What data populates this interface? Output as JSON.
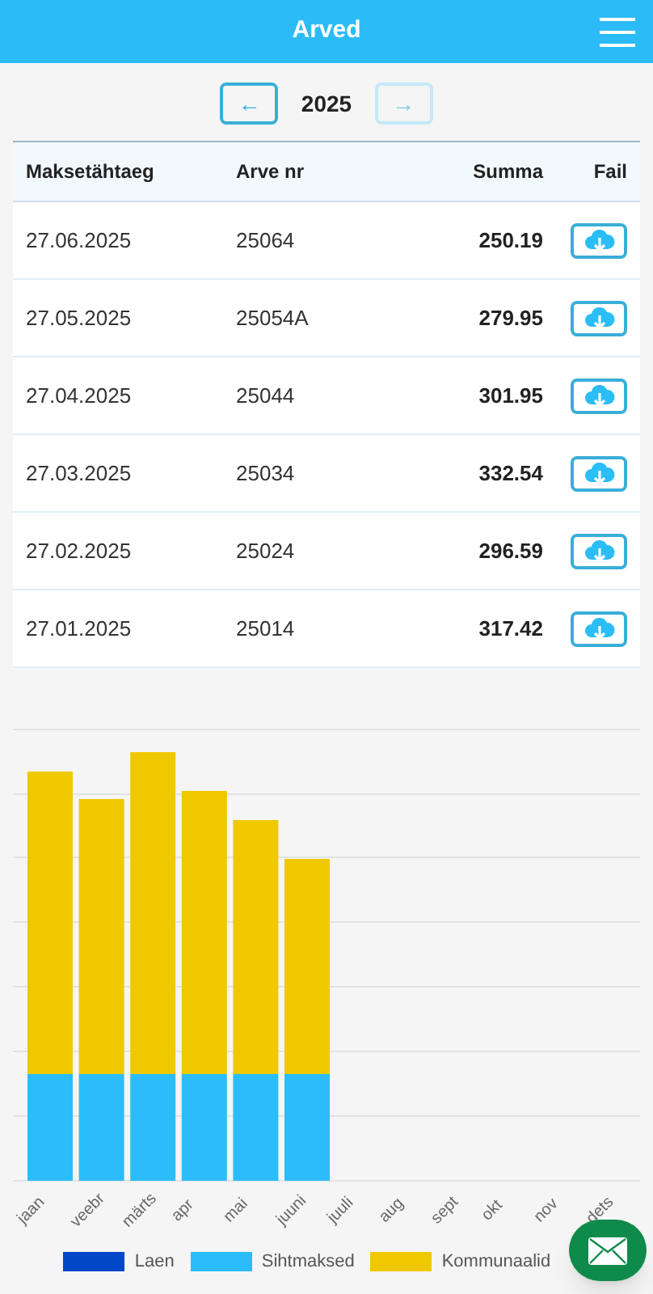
{
  "header": {
    "title": "Arved"
  },
  "year_nav": {
    "prev": {
      "label": "←",
      "disabled": false
    },
    "year": "2025",
    "next": {
      "label": "→",
      "disabled": true
    }
  },
  "table": {
    "columns": [
      "Maksetähtaeg",
      "Arve nr",
      "Summa",
      "Fail"
    ],
    "rows": [
      {
        "date": "27.06.2025",
        "number": "25064",
        "sum": "250.19"
      },
      {
        "date": "27.05.2025",
        "number": "25054A",
        "sum": "279.95"
      },
      {
        "date": "27.04.2025",
        "number": "25044",
        "sum": "301.95"
      },
      {
        "date": "27.03.2025",
        "number": "25034",
        "sum": "332.54"
      },
      {
        "date": "27.02.2025",
        "number": "25024",
        "sum": "296.59"
      },
      {
        "date": "27.01.2025",
        "number": "25014",
        "sum": "317.42"
      }
    ]
  },
  "chart": {
    "months": [
      "jaan",
      "veebr",
      "märts",
      "apr",
      "mai",
      "juuni",
      "juuli",
      "aug",
      "sept",
      "okt",
      "nov",
      "dets"
    ],
    "legend": [
      {
        "label": "Laen",
        "color": "#0047c8"
      },
      {
        "label": "Sihtmaksed",
        "color": "#2bbdfb"
      },
      {
        "label": "Kommunaalid",
        "color": "#f0c800"
      }
    ]
  }
}
